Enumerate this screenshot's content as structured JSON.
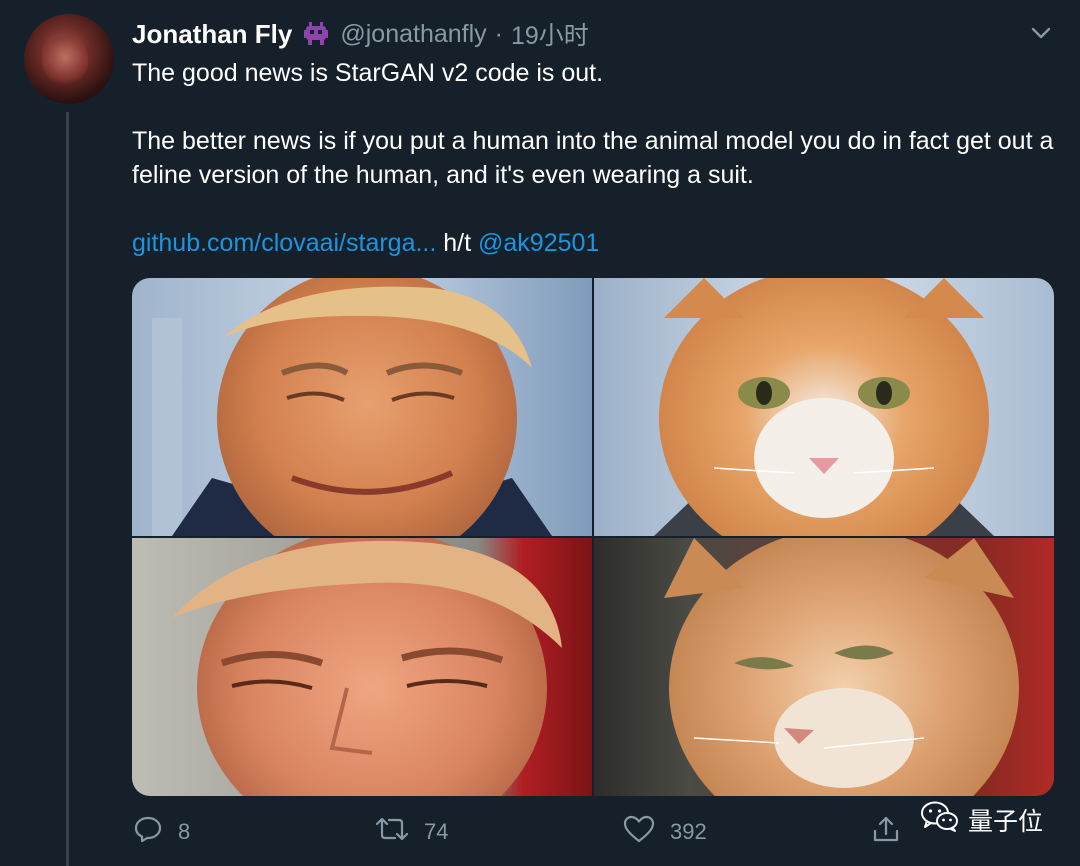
{
  "author": {
    "display_name": "Jonathan Fly",
    "badge_icon": "alien-monster-icon",
    "handle": "@jonathanfly",
    "separator": "·",
    "time": "19小时"
  },
  "tweet": {
    "line1": "The good news is StarGAN v2 code is out.",
    "line2": "The better news is if you put a human into the animal model you do in fact get out a feline version of the human, and it's even wearing a suit.",
    "link_text": "github.com/clovaai/starga...",
    "ht_text": " h/t ",
    "mention": "@ak92501",
    "link_color": "#1b95e0"
  },
  "media": {
    "photos": [
      "photo-man-1",
      "photo-cat-1",
      "photo-man-2",
      "photo-cat-2"
    ]
  },
  "actions": {
    "reply_count": "8",
    "retweet_count": "74",
    "like_count": "392"
  },
  "watermark": {
    "text": "量子位"
  },
  "colors": {
    "background": "#15202b",
    "secondary_text": "#8899a6",
    "thread_line": "#38444d"
  }
}
